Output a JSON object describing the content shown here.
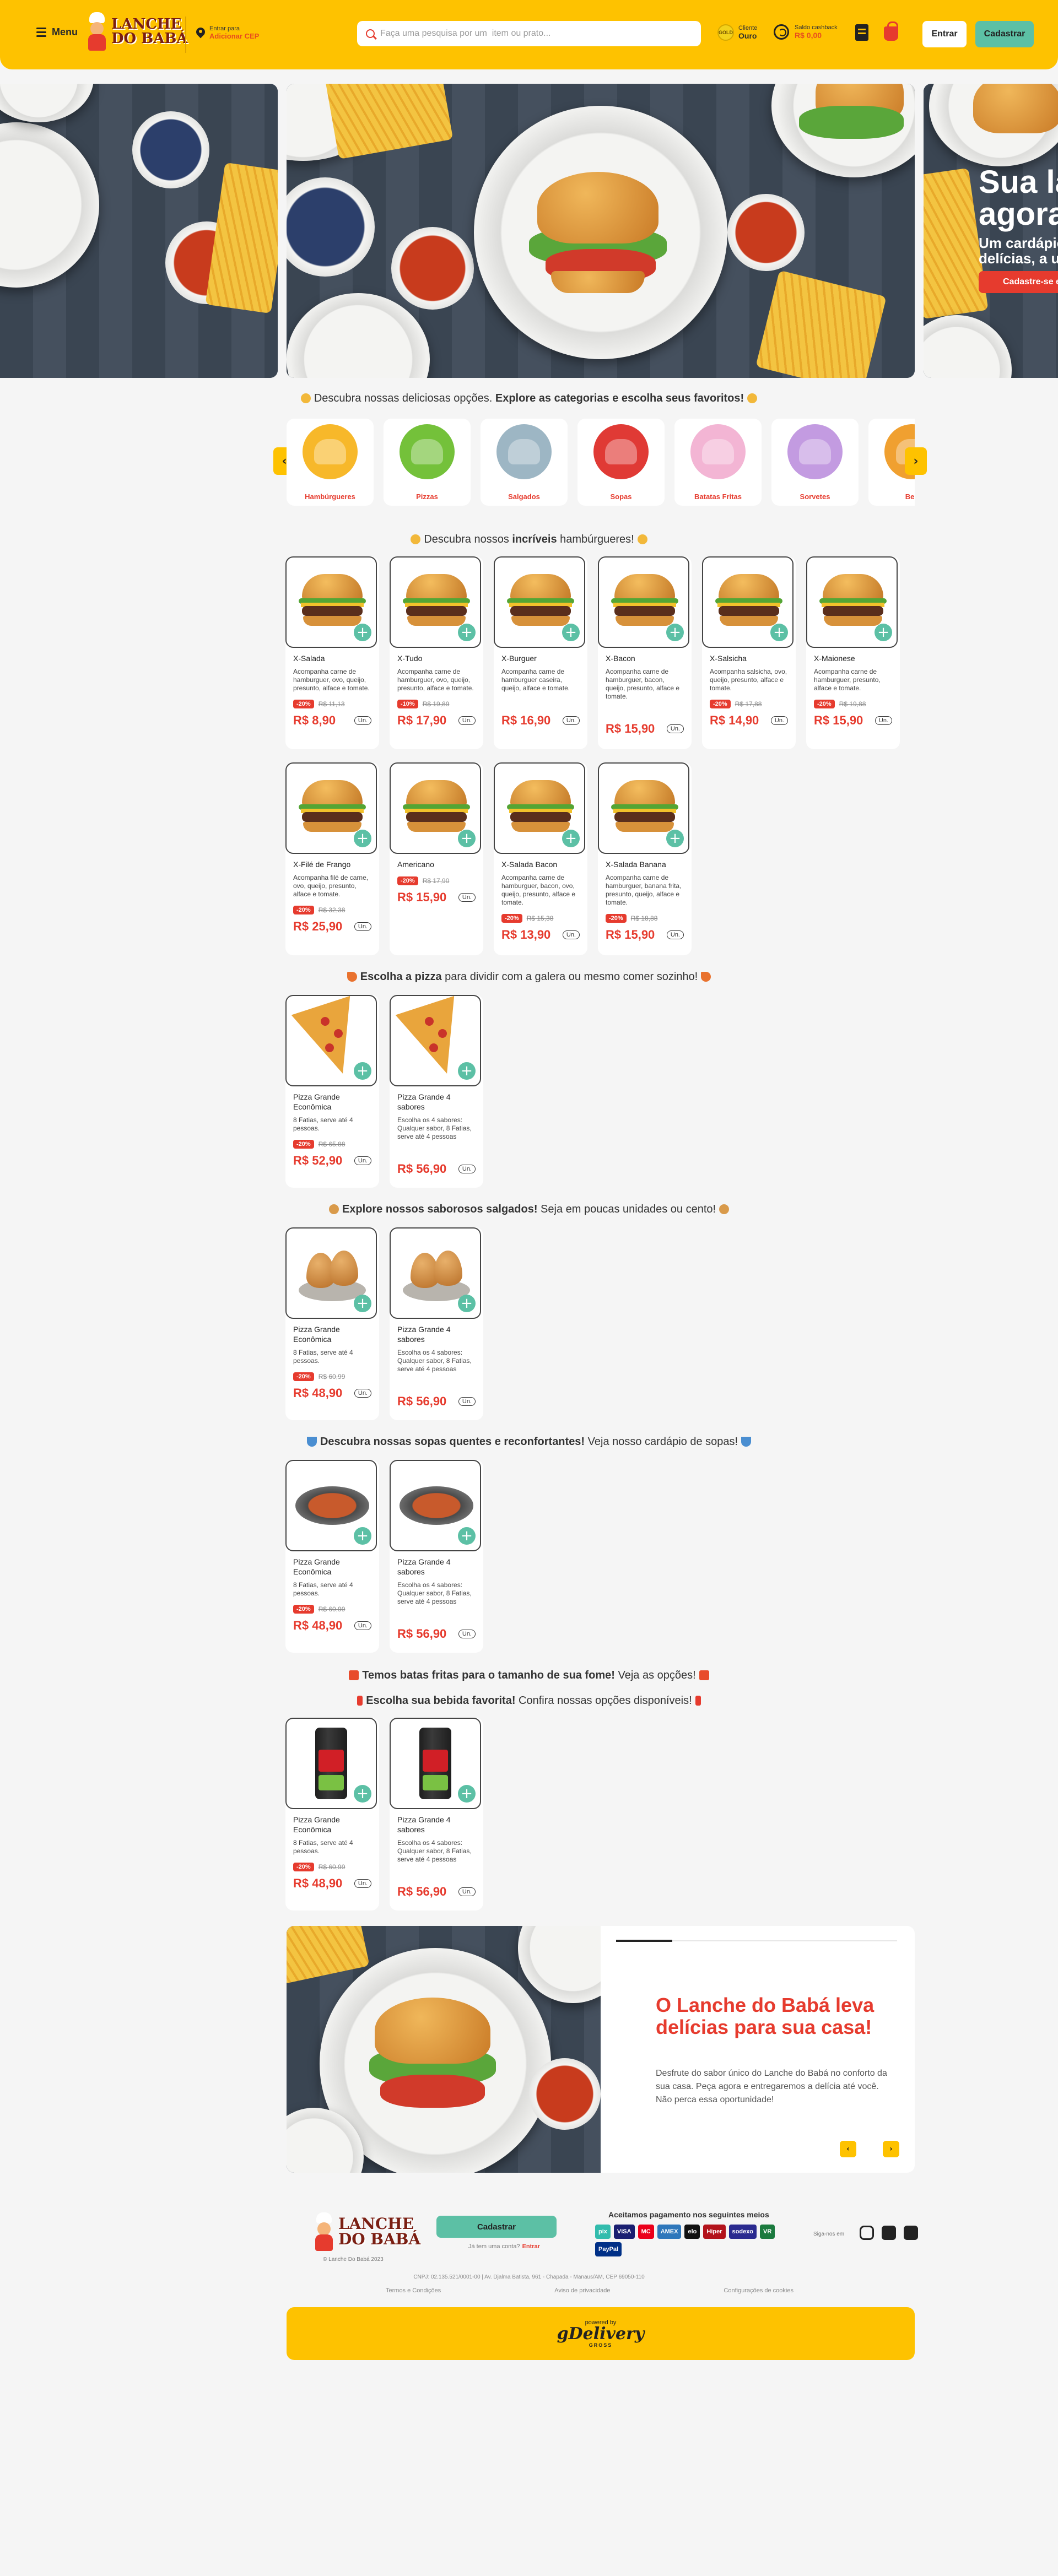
{
  "header": {
    "menu_label": "Menu",
    "logo_line1": "LANCHE",
    "logo_line2": "DO BABÁ",
    "cep_label": "Entrar para",
    "cep_action": "Adicionar CEP",
    "search_placeholder": "Faça uma pesquisa por um  item ou prato...",
    "coin_text": "GOLD",
    "client_label": "Cliente",
    "client_tier": "Ouro",
    "cashback_label": "Saldo cashback",
    "cashback_value": "R$ 0,00",
    "login_label": "Entrar",
    "signup_label": "Cadastrar"
  },
  "hero": {
    "headline1": "Sua la",
    "headline2": "agora",
    "sub1": "Um cardápio",
    "sub2": "delícias, a um",
    "cta": "Cadastre-se e"
  },
  "categories": {
    "title_pre": "Descubra nossas deliciosas opções. ",
    "title_bold": "Explore as categorias e escolha seus favoritos!",
    "items": [
      {
        "label": "Hambúrgueres",
        "bg": "#f7b82a"
      },
      {
        "label": "Pizzas",
        "bg": "#74c13a"
      },
      {
        "label": "Salgados",
        "bg": "#9db6c4"
      },
      {
        "label": "Sopas",
        "bg": "#e03a35"
      },
      {
        "label": "Batatas Fritas",
        "bg": "#f3b5d4"
      },
      {
        "label": "Sorvetes",
        "bg": "#c39be1"
      },
      {
        "label": "Beb",
        "bg": "#f0a030"
      }
    ]
  },
  "burgers": {
    "title_pre": "Descubra nossos ",
    "title_bold": "incríveis",
    "title_post": " hambúrgueres!",
    "items": [
      {
        "name": "X-Salada",
        "desc": "Acompanha carne de hamburguer, ovo, queijo, presunto, alface e tomate.",
        "badge": "-20%",
        "old": "R$ 11,13",
        "price": "R$ 8,90",
        "unit": "Un."
      },
      {
        "name": "X-Tudo",
        "desc": "Acompanha carne de hamburguer, ovo, queijo, presunto, alface e tomate.",
        "badge": "-10%",
        "old": "R$ 19,89",
        "price": "R$ 17,90",
        "unit": "Un."
      },
      {
        "name": "X-Burguer",
        "desc": "Acompanha carne de hamburguer caseira, queijo, alface e tomate.",
        "badge": "",
        "old": "",
        "price": "R$ 16,90",
        "unit": "Un."
      },
      {
        "name": "X-Bacon",
        "desc": "Acompanha carne de hamburguer, bacon, queijo, presunto, alface e tomate.",
        "badge": "",
        "old": "",
        "price": "R$ 15,90",
        "unit": "Un."
      },
      {
        "name": "X-Salsicha",
        "desc": "Acompanha salsicha, ovo, queijo, presunto, alface e tomate.",
        "badge": "-20%",
        "old": "R$ 17,88",
        "price": "R$ 14,90",
        "unit": "Un."
      },
      {
        "name": "X-Maionese",
        "desc": "Acompanha carne de hamburguer, presunto, alface e tomate.",
        "badge": "-20%",
        "old": "R$ 19,88",
        "price": "R$ 15,90",
        "unit": "Un."
      },
      {
        "name": "X-Filé de Frango",
        "desc": "Acompanha filé de carne, ovo, queijo, presunto, alface e tomate.",
        "badge": "-20%",
        "old": "R$ 32,38",
        "price": "R$ 25,90",
        "unit": "Un."
      },
      {
        "name": "Americano",
        "desc": "",
        "badge": "-20%",
        "old": "R$ 17,90",
        "price": "R$ 15,90",
        "unit": "Un."
      },
      {
        "name": "X-Salada Bacon",
        "desc": "Acompanha carne de hamburguer, bacon, ovo, queijo, presunto, alface e tomate.",
        "badge": "-20%",
        "old": "R$ 15,38",
        "price": "R$ 13,90",
        "unit": "Un."
      },
      {
        "name": "X-Salada Banana",
        "desc": "Acompanha carne de hamburguer, banana frita, presunto, queijo, alface e tomate.",
        "badge": "-20%",
        "old": "R$ 18,88",
        "price": "R$ 15,90",
        "unit": "Un."
      }
    ]
  },
  "pizzas": {
    "title_bold": "Escolha a pizza",
    "title_post": " para dividir com a galera ou mesmo comer sozinho!",
    "items": [
      {
        "name": "Pizza Grande Econômica",
        "desc": "8 Fatias, serve até 4 pessoas.",
        "badge": "-20%",
        "old": "R$ 65,88",
        "price": "R$ 52,90",
        "unit": "Un."
      },
      {
        "name": "Pizza Grande 4 sabores",
        "desc": "Escolha os 4 sabores: Qualquer sabor, 8 Fatias, serve até 4 pessoas",
        "badge": "",
        "old": "",
        "price": "R$ 56,90",
        "unit": "Un."
      }
    ]
  },
  "salgados": {
    "title_bold": "Explore nossos saborosos salgados!",
    "title_post": " Seja em poucas unidades ou cento!",
    "items": [
      {
        "name": "Pizza Grande Econômica",
        "desc": "8 Fatias, serve até 4 pessoas.",
        "badge": "-20%",
        "old": "R$ 60,99",
        "price": "R$ 48,90",
        "unit": "Un."
      },
      {
        "name": "Pizza Grande 4 sabores",
        "desc": "Escolha os 4 sabores: Qualquer sabor, 8 Fatias, serve até 4 pessoas",
        "badge": "",
        "old": "",
        "price": "R$ 56,90",
        "unit": "Un."
      }
    ]
  },
  "sopas": {
    "title_bold": "Descubra nossas sopas quentes e reconfortantes!",
    "title_post": " Veja nosso cardápio de sopas!",
    "items": [
      {
        "name": "Pizza Grande Econômica",
        "desc": "8 Fatias, serve até 4 pessoas.",
        "badge": "-20%",
        "old": "R$ 60,99",
        "price": "R$ 48,90",
        "unit": "Un."
      },
      {
        "name": "Pizza Grande 4 sabores",
        "desc": "Escolha os 4 sabores: Qualquer sabor, 8 Fatias, serve até 4 pessoas",
        "badge": "",
        "old": "",
        "price": "R$ 56,90",
        "unit": "Un."
      }
    ]
  },
  "fries": {
    "title_bold": "Temos batas fritas para o tamanho de sua fome!",
    "title_post": " Veja as opções!"
  },
  "drinks": {
    "title_bold": "Escolha sua bebida favorita!",
    "title_post": " Confira nossas opções disponíveis!",
    "items": [
      {
        "name": "Pizza Grande Econômica",
        "desc": "8 Fatias, serve até 4 pessoas.",
        "badge": "-20%",
        "old": "R$ 60,99",
        "price": "R$ 48,90",
        "unit": "Un."
      },
      {
        "name": "Pizza Grande 4 sabores",
        "desc": "Escolha os 4 sabores: Qualquer sabor, 8 Fatias, serve até 4 pessoas",
        "badge": "",
        "old": "",
        "price": "R$ 56,90",
        "unit": "Un."
      }
    ]
  },
  "promo": {
    "title": "O Lanche do Babá leva delícias para sua casa!",
    "text": "Desfrute do sabor único do Lanche do Babá no conforto da sua casa. Peça agora e entregaremos a delícia até você. Não perca essa oportunidade!",
    "progress": 0.2
  },
  "footer": {
    "copyright": "© Lanche Do Babá 2023",
    "signup": "Cadastrar",
    "has_account": "Já tem uma conta?",
    "login": "Entrar",
    "payments_title": "Aceitamos pagamento nos seguintes meios",
    "payments": [
      {
        "label": "pix",
        "color": "#32bcad"
      },
      {
        "label": "VISA",
        "color": "#1a1f71"
      },
      {
        "label": "MC",
        "color": "#eb001b"
      },
      {
        "label": "AMEX",
        "color": "#2e77bb"
      },
      {
        "label": "elo",
        "color": "#111111"
      },
      {
        "label": "Hiper",
        "color": "#b3131b"
      },
      {
        "label": "sodexo",
        "color": "#2a2a8f"
      },
      {
        "label": "VR",
        "color": "#1b7a3e"
      },
      {
        "label": "PayPal",
        "color": "#003087"
      }
    ],
    "follow": "Siga-nos em",
    "address": "CNPJ: 02.135.521/0001-00 | Av. Djalma Batista, 961 - Chapada - Manaus/AM, CEP 69050-110",
    "links": [
      "Termos e Condições",
      "Aviso de privacidade",
      "Configurações de cookies"
    ],
    "powered_by": "powered by",
    "powered_brand": "gDelivery",
    "powered_sub": "GROSS"
  }
}
